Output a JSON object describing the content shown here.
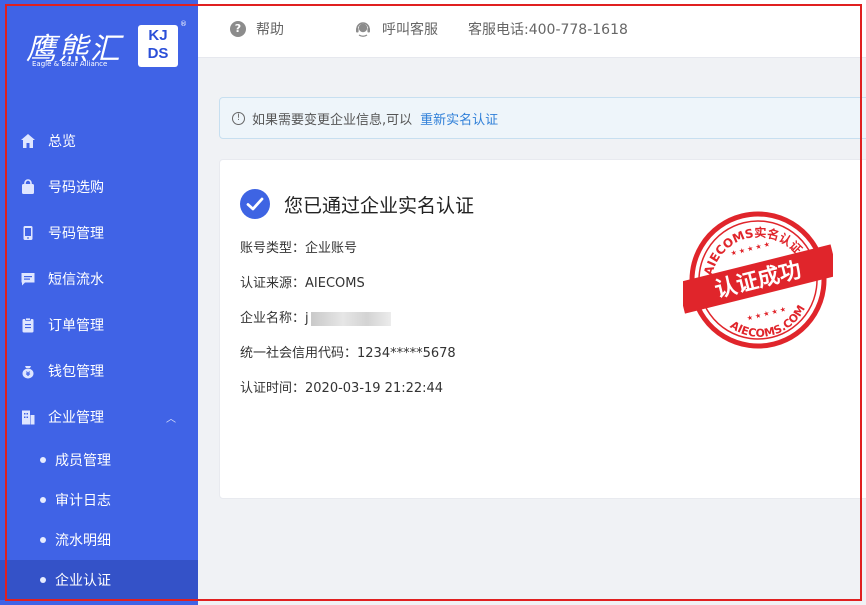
{
  "logo": {
    "cn": "鹰熊汇",
    "en": "Eagle & Bear Alliance",
    "badge": "KJDS",
    "badge_line1": "KJ",
    "badge_line2": "DS",
    "registered": "®"
  },
  "sidebar": {
    "items": [
      {
        "label": "总览",
        "icon": "home-icon"
      },
      {
        "label": "号码选购",
        "icon": "bag-icon"
      },
      {
        "label": "号码管理",
        "icon": "phone-icon"
      },
      {
        "label": "短信流水",
        "icon": "message-icon"
      },
      {
        "label": "订单管理",
        "icon": "clipboard-icon"
      },
      {
        "label": "钱包管理",
        "icon": "wallet-icon"
      },
      {
        "label": "企业管理",
        "icon": "building-icon",
        "expanded": true
      }
    ],
    "sub_items": [
      {
        "label": "成员管理"
      },
      {
        "label": "审计日志"
      },
      {
        "label": "流水明细"
      },
      {
        "label": "企业认证",
        "active": true
      }
    ]
  },
  "topbar": {
    "help": "帮助",
    "customer_service": "呼叫客服",
    "phone": "客服电话:400-778-1618"
  },
  "notice": {
    "text": "如果需要变更企业信息,可以",
    "link": "重新实名认证"
  },
  "card": {
    "title": "您已通过企业实名认证",
    "account_type": "账号类型：企业账号",
    "cert_source": "认证来源：AIECOMS",
    "company_name_label": "企业名称：",
    "company_name_visible": "j",
    "credit_code": "统一社会信用代码：1234*****5678",
    "cert_time": "认证时间：2020-03-19 21:22:44"
  },
  "stamp": {
    "ring_top": "AIECOMS实名认证",
    "ring_bottom": "AIECOMS.COM",
    "banner": "认证成功",
    "color": "#e0252b"
  },
  "colors": {
    "sidebar": "#4063e6",
    "accent": "#3e64e3",
    "link": "#2f7fd8",
    "frame": "#e02020"
  }
}
